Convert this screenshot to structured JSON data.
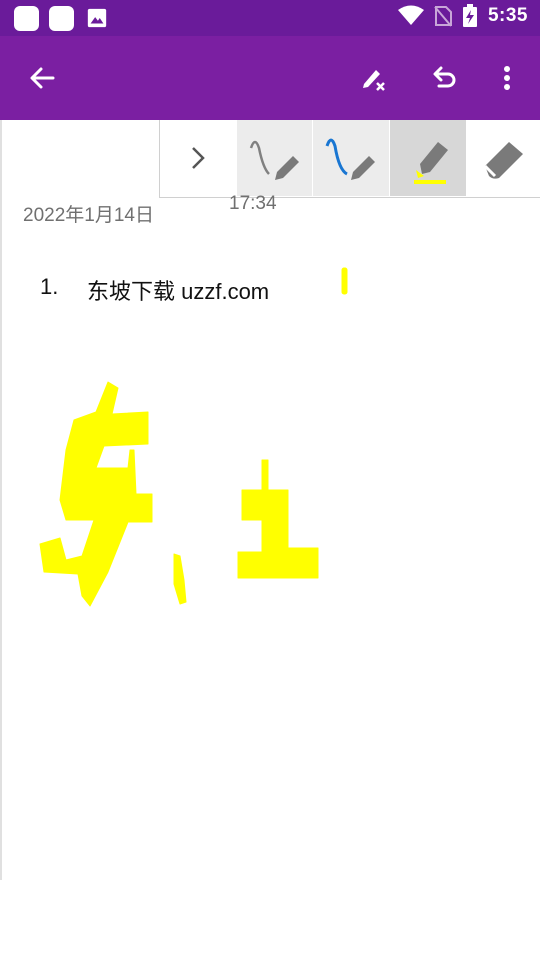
{
  "status_bar": {
    "time": "5:35",
    "left_icons": [
      "notification-square-icon",
      "notification-square-icon",
      "image-icon"
    ],
    "right_icons": [
      "wifi-icon",
      "no-sim-icon",
      "battery-charging-icon"
    ]
  },
  "app_bar": {
    "color": "#7b1fa2",
    "back": "arrow-back-icon",
    "clear_ink": "pen-clear-icon",
    "undo": "undo-icon",
    "more": "more-vert-icon"
  },
  "toolbar": {
    "tools": [
      "expand-chevron-icon",
      "pen-gray-icon",
      "pen-blue-icon",
      "highlighter-yellow-icon",
      "eraser-icon"
    ],
    "selected": "highlighter-yellow-icon"
  },
  "note": {
    "date": "2022年1月14日",
    "time": "17:34",
    "list_number": "1.",
    "list_text": "东坡下载 uzzf.com"
  },
  "ink": {
    "color": "#ffff00"
  }
}
